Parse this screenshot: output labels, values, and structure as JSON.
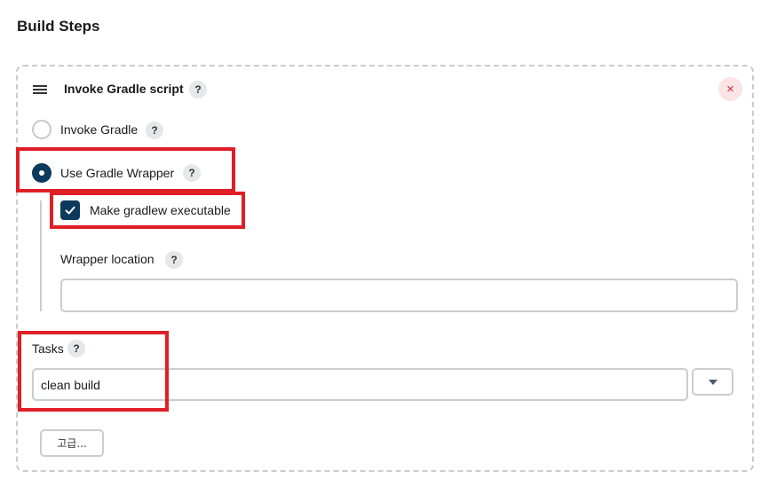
{
  "section": {
    "title": "Build Steps"
  },
  "step": {
    "title": "Invoke Gradle script",
    "help_glyph": "?",
    "close_glyph": "×",
    "drag_icon": "hamburger-icon"
  },
  "options": {
    "invoke_gradle": {
      "label": "Invoke Gradle",
      "selected": false
    },
    "use_wrapper": {
      "label": "Use Gradle Wrapper",
      "selected": true
    },
    "make_executable": {
      "label": "Make gradlew executable",
      "checked": true
    }
  },
  "wrapper_location": {
    "label": "Wrapper location",
    "value": ""
  },
  "tasks": {
    "label": "Tasks",
    "value": "clean build"
  },
  "advanced": {
    "label": "고급..."
  },
  "colors": {
    "accent": "#0b3a5c",
    "highlight": "#e01e26",
    "close": "#d12b3a"
  }
}
